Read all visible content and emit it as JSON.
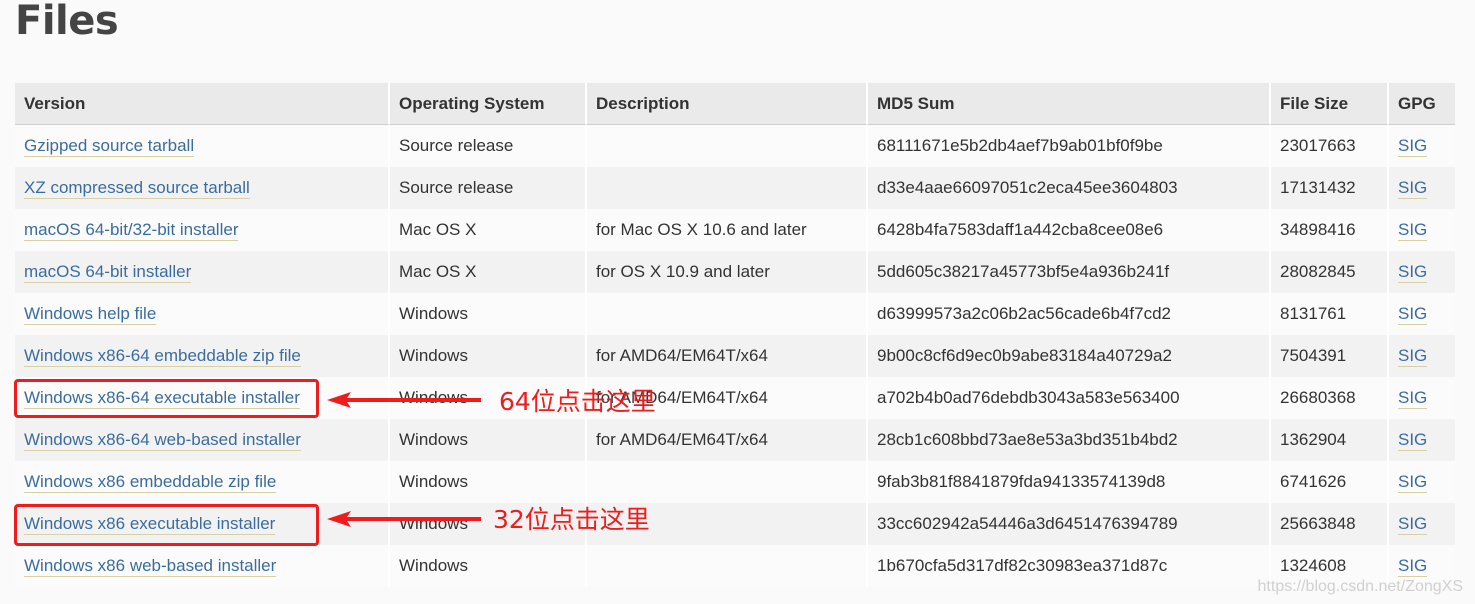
{
  "page": {
    "title": "Files"
  },
  "table": {
    "headers": [
      "Version",
      "Operating System",
      "Description",
      "MD5 Sum",
      "File Size",
      "GPG"
    ],
    "rows": [
      {
        "version": "Gzipped source tarball",
        "os": "Source release",
        "description": "",
        "md5": "68111671e5b2db4aef7b9ab01bf0f9be",
        "size": "23017663",
        "gpg": "SIG"
      },
      {
        "version": "XZ compressed source tarball",
        "os": "Source release",
        "description": "",
        "md5": "d33e4aae66097051c2eca45ee3604803",
        "size": "17131432",
        "gpg": "SIG"
      },
      {
        "version": "macOS 64-bit/32-bit installer",
        "os": "Mac OS X",
        "description": "for Mac OS X 10.6 and later",
        "md5": "6428b4fa7583daff1a442cba8cee08e6",
        "size": "34898416",
        "gpg": "SIG"
      },
      {
        "version": "macOS 64-bit installer",
        "os": "Mac OS X",
        "description": "for OS X 10.9 and later",
        "md5": "5dd605c38217a45773bf5e4a936b241f",
        "size": "28082845",
        "gpg": "SIG"
      },
      {
        "version": "Windows help file",
        "os": "Windows",
        "description": "",
        "md5": "d63999573a2c06b2ac56cade6b4f7cd2",
        "size": "8131761",
        "gpg": "SIG"
      },
      {
        "version": "Windows x86-64 embeddable zip file",
        "os": "Windows",
        "description": "for AMD64/EM64T/x64",
        "md5": "9b00c8cf6d9ec0b9abe83184a40729a2",
        "size": "7504391",
        "gpg": "SIG"
      },
      {
        "version": "Windows x86-64 executable installer",
        "os": "Windows",
        "description": "for AMD64/EM64T/x64",
        "md5": "a702b4b0ad76debdb3043a583e563400",
        "size": "26680368",
        "gpg": "SIG"
      },
      {
        "version": "Windows x86-64 web-based installer",
        "os": "Windows",
        "description": "for AMD64/EM64T/x64",
        "md5": "28cb1c608bbd73ae8e53a3bd351b4bd2",
        "size": "1362904",
        "gpg": "SIG"
      },
      {
        "version": "Windows x86 embeddable zip file",
        "os": "Windows",
        "description": "",
        "md5": "9fab3b81f8841879fda94133574139d8",
        "size": "6741626",
        "gpg": "SIG"
      },
      {
        "version": "Windows x86 executable installer",
        "os": "Windows",
        "description": "",
        "md5": "33cc602942a54446a3d6451476394789",
        "size": "25663848",
        "gpg": "SIG"
      },
      {
        "version": "Windows x86 web-based installer",
        "os": "Windows",
        "description": "",
        "md5": "1b670cfa5d317df82c30983ea371d87c",
        "size": "1324608",
        "gpg": "SIG"
      }
    ]
  },
  "annotations": {
    "note_64": "64位点击这里",
    "note_32": "32位点击这里",
    "color": "#ee1c1c"
  },
  "watermark": "https://blog.csdn.net/ZongXS"
}
